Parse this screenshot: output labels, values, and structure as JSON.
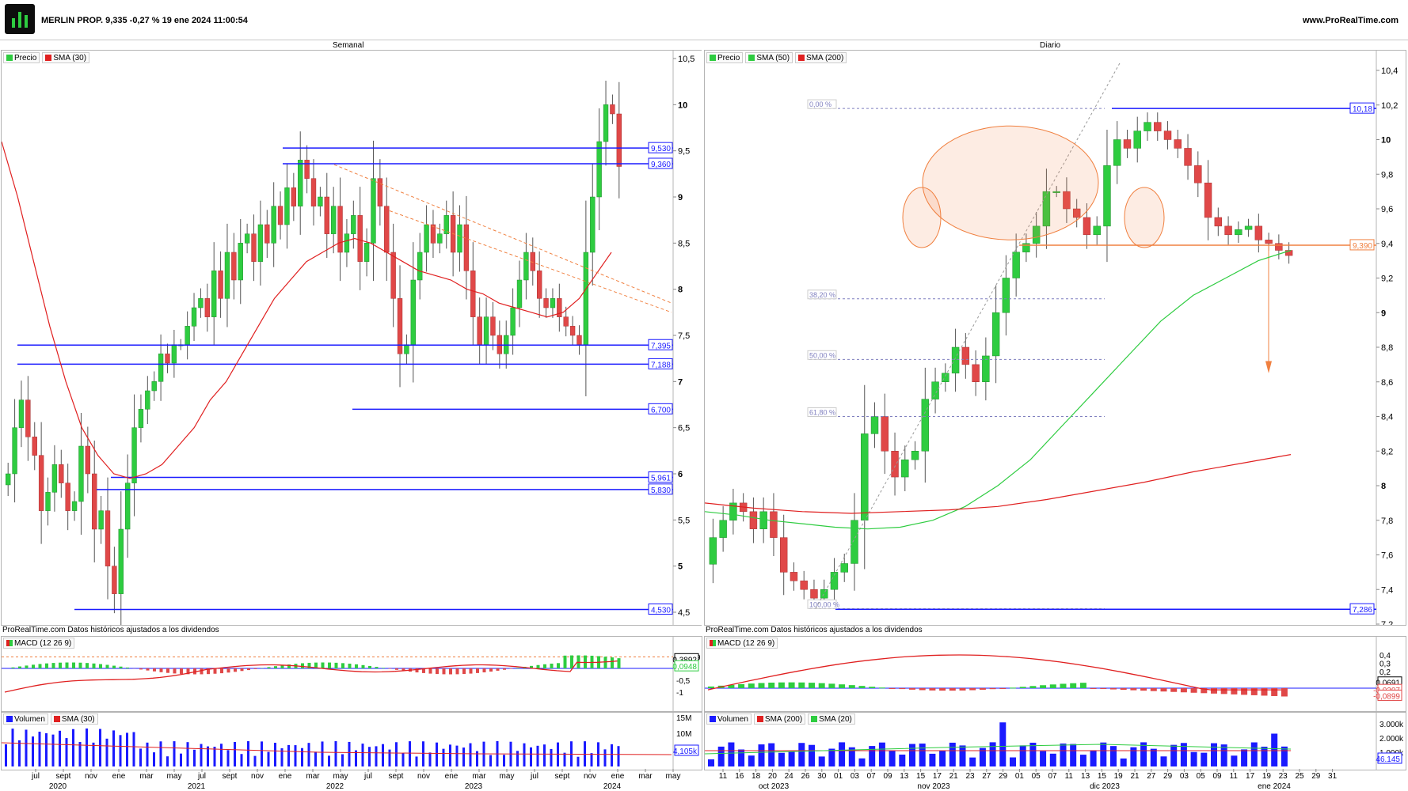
{
  "header": {
    "title": "MERLIN PROP. 9,335 -0,27 % 19 ene 2024 11:00:54",
    "site": "www.ProRealTime.com"
  },
  "colors": {
    "up": "#2ecc40",
    "down": "#e04848",
    "sma_red": "#e02020",
    "sma_green": "#2ecc40",
    "levels": "#1a1aff",
    "fib": "#7f7fbf",
    "orange": "#f08040"
  },
  "weekly": {
    "title": "Semanal",
    "legend": {
      "price": "Precio",
      "sma": "SMA (30)"
    },
    "price_axis": [
      "10,5",
      "10",
      "9,5",
      "9",
      "8,5",
      "8",
      "7,5",
      "7",
      "6,5",
      "6",
      "5,5",
      "5",
      "4,5"
    ],
    "levels": [
      "9,530",
      "9,360",
      "7,395",
      "7,188",
      "6,700",
      "5,961",
      "5,830",
      "4,530"
    ],
    "note": "ProRealTime.com Datos históricos ajustados a los dividendos",
    "macd": {
      "label": "MACD (12 26 9)",
      "axis": [
        "0,4849",
        "-0,5",
        "-1"
      ],
      "values": [
        "0,3892",
        "0,0948"
      ]
    },
    "volume": {
      "label_vol": "Volumen",
      "label_sma": "SMA (30)",
      "axis": [
        "15M",
        "10M",
        "5M"
      ],
      "value": "4,105k"
    },
    "x_months": [
      "jul",
      "sept",
      "nov",
      "ene",
      "mar",
      "may",
      "jul",
      "sept",
      "nov",
      "ene",
      "mar",
      "may",
      "jul",
      "sept",
      "nov",
      "ene",
      "mar",
      "may",
      "jul",
      "sept",
      "nov",
      "ene",
      "mar",
      "may"
    ],
    "x_years": [
      "2020",
      "2021",
      "2022",
      "2023",
      "2024"
    ]
  },
  "daily": {
    "title": "Diario",
    "legend": {
      "price": "Precio",
      "sma50": "SMA (50)",
      "sma200": "SMA (200)"
    },
    "price_axis": [
      "10,4",
      "10,2",
      "10",
      "9,8",
      "9,6",
      "9,4",
      "9,2",
      "9",
      "8,8",
      "8,6",
      "8,4",
      "8,2",
      "8",
      "7,8",
      "7,6",
      "7,4",
      "7,2"
    ],
    "levels": [
      "10,18",
      "9,390",
      "7,286"
    ],
    "fib": [
      "0,00 %",
      "38,20 %",
      "50,00 %",
      "61,80 %",
      "100,00 %"
    ],
    "note": "ProRealTime.com Datos históricos ajustados a los dividendos",
    "macd": {
      "label": "MACD (12 26 9)",
      "axis": [
        "0,4",
        "0,3",
        "0,2",
        "0,1",
        "-0,1"
      ],
      "values": [
        "0,0691",
        "-0,0207",
        "-0,0899"
      ]
    },
    "volume": {
      "label_vol": "Volumen",
      "label_sma200": "SMA (200)",
      "label_sma20": "SMA (20)",
      "axis": [
        "3.000k",
        "2.000k",
        "1.000k"
      ],
      "value": "46.145"
    },
    "x_days": [
      "11",
      "16",
      "18",
      "20",
      "24",
      "26",
      "30",
      "01",
      "03",
      "07",
      "09",
      "13",
      "15",
      "17",
      "21",
      "23",
      "27",
      "29",
      "01",
      "05",
      "07",
      "11",
      "13",
      "15",
      "19",
      "21",
      "27",
      "29",
      "03",
      "05",
      "09",
      "11",
      "17",
      "19",
      "23",
      "25",
      "29",
      "31"
    ],
    "x_months": [
      "oct 2023",
      "nov 2023",
      "dic 2023",
      "ene 2024"
    ]
  },
  "chart_data": [
    {
      "type": "candlestick",
      "title": "Semanal",
      "ylim": [
        4.5,
        10.5
      ],
      "series": [
        {
          "name": "Precio"
        },
        {
          "name": "SMA (30)"
        }
      ],
      "levels": [
        9.53,
        9.36,
        7.395,
        7.188,
        6.7,
        5.961,
        5.83,
        4.53
      ],
      "closes": [
        6.0,
        6.5,
        6.8,
        6.4,
        6.2,
        5.6,
        5.8,
        6.1,
        5.9,
        5.6,
        5.7,
        6.3,
        6.0,
        5.4,
        5.6,
        5.0,
        4.7,
        5.4,
        5.9,
        6.5,
        6.7,
        6.9,
        7.0,
        7.3,
        7.2,
        7.4,
        7.4,
        7.6,
        7.8,
        7.9,
        7.7,
        8.2,
        7.9,
        8.4,
        8.1,
        8.5,
        8.6,
        8.3,
        8.7,
        8.5,
        8.9,
        8.7,
        9.1,
        8.9,
        9.4,
        9.2,
        8.9,
        9.0,
        8.6,
        8.9,
        8.4,
        8.6,
        8.8,
        8.3,
        8.5,
        9.2,
        8.9,
        8.4,
        7.9,
        7.3,
        7.4,
        8.1,
        8.4,
        8.7,
        8.5,
        8.6,
        8.8,
        8.4,
        8.7,
        8.2,
        7.7,
        7.4,
        7.7,
        7.5,
        7.3,
        7.5,
        7.8,
        8.1,
        8.4,
        8.2,
        7.9,
        7.8,
        7.9,
        7.7,
        7.6,
        7.5,
        7.4,
        8.4,
        9.0,
        9.6,
        10.0,
        9.9,
        9.33
      ],
      "sma30": [
        9.6,
        9.0,
        8.3,
        7.6,
        7.0,
        6.5,
        6.2,
        6.0,
        5.95,
        6.0,
        6.1,
        6.3,
        6.5,
        6.8,
        7.0,
        7.3,
        7.6,
        7.9,
        8.1,
        8.3,
        8.4,
        8.5,
        8.55,
        8.5,
        8.4,
        8.3,
        8.2,
        8.15,
        8.1,
        8.0,
        7.95,
        7.85,
        7.8,
        7.75,
        7.7,
        7.75,
        7.9,
        8.15,
        8.4
      ]
    },
    {
      "type": "candlestick",
      "title": "Diario",
      "ylim": [
        7.2,
        10.4
      ],
      "series": [
        {
          "name": "Precio"
        },
        {
          "name": "SMA (50)"
        },
        {
          "name": "SMA (200)"
        }
      ],
      "levels": [
        10.18,
        9.39,
        7.286
      ],
      "fibonacci": [
        {
          "label": "0,00 %",
          "value": 10.18
        },
        {
          "label": "38,20 %",
          "value": 9.08
        },
        {
          "label": "50,00 %",
          "value": 8.73
        },
        {
          "label": "61,80 %",
          "value": 8.4
        },
        {
          "label": "100,00 %",
          "value": 7.29
        }
      ],
      "closes": [
        7.7,
        7.8,
        7.9,
        7.85,
        7.75,
        7.85,
        7.7,
        7.5,
        7.45,
        7.4,
        7.35,
        7.4,
        7.5,
        7.55,
        7.8,
        8.3,
        8.4,
        8.2,
        8.05,
        8.15,
        8.2,
        8.5,
        8.6,
        8.65,
        8.8,
        8.7,
        8.6,
        8.75,
        9.0,
        9.2,
        9.35,
        9.4,
        9.5,
        9.7,
        9.7,
        9.6,
        9.55,
        9.45,
        9.5,
        9.85,
        10.0,
        9.95,
        10.05,
        10.1,
        10.05,
        10.0,
        9.95,
        9.85,
        9.75,
        9.55,
        9.5,
        9.45,
        9.48,
        9.5,
        9.42,
        9.4,
        9.36,
        9.33
      ],
      "sma50": [
        7.85,
        7.83,
        7.8,
        7.78,
        7.76,
        7.75,
        7.76,
        7.8,
        7.88,
        8.0,
        8.15,
        8.35,
        8.55,
        8.75,
        8.95,
        9.1,
        9.2,
        9.3,
        9.36
      ],
      "sma200": [
        7.9,
        7.87,
        7.85,
        7.84,
        7.85,
        7.86,
        7.88,
        7.92,
        7.97,
        8.02,
        8.08,
        8.13,
        8.18
      ]
    }
  ]
}
